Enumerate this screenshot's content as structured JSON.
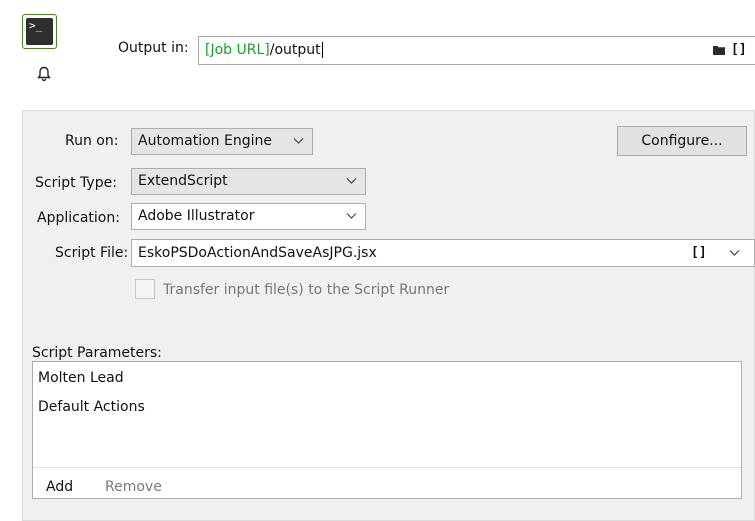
{
  "header": {
    "output_label": "Output in:",
    "output_value_var": "[Job URL]",
    "output_value_rest": "/output",
    "bracket_icon_text": "[]",
    "icons": [
      "terminal-icon",
      "bell-icon",
      "folder-icon"
    ]
  },
  "settings": {
    "run_on": {
      "label": "Run on:",
      "value": "Automation Engine"
    },
    "configure_label": "Configure...",
    "script_type": {
      "label": "Script Type:",
      "value": "ExtendScript"
    },
    "application": {
      "label": "Application:",
      "value": "Adobe Illustrator"
    },
    "script_file": {
      "label": "Script File:",
      "value": "EskoPSDoActionAndSaveAsJPG.jsx",
      "bracket_text": "[]"
    },
    "transfer": {
      "label": "Transfer input file(s) to the Script Runner",
      "checked": false,
      "enabled": false
    }
  },
  "parameters": {
    "label": "Script Parameters:",
    "items": [
      "Molten Lead",
      "Default Actions"
    ],
    "add_label": "Add",
    "remove_label": "Remove"
  },
  "colors": {
    "variable_green": "#19a02a",
    "panel_bg": "#f0f0f0",
    "terminal_border": "#4f7f28"
  }
}
